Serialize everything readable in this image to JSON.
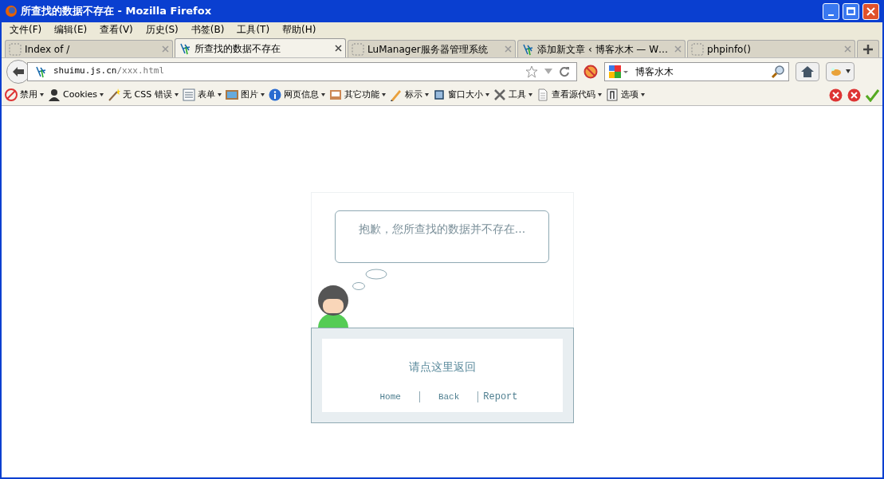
{
  "window": {
    "title": "所查找的数据不存在 - Mozilla Firefox"
  },
  "menu": [
    "文件(F)",
    "编辑(E)",
    "查看(V)",
    "历史(S)",
    "书签(B)",
    "工具(T)",
    "帮助(H)"
  ],
  "tabs": [
    {
      "label": "Index of /",
      "kind": "blank",
      "selected": false
    },
    {
      "label": "所查找的数据不存在",
      "kind": "favicon",
      "selected": true
    },
    {
      "label": "LuManager服务器管理系统",
      "kind": "blank",
      "selected": false
    },
    {
      "label": "添加新文章 ‹ 博客水木 — W…",
      "kind": "favicon",
      "selected": false
    },
    {
      "label": "phpinfo()",
      "kind": "blank",
      "selected": false
    }
  ],
  "address": {
    "host": "shuimu.js.cn",
    "path": "/xxx.html"
  },
  "search": {
    "value": "博客水木"
  },
  "toolbar": [
    "禁用",
    "Cookies",
    "无 CSS 错误",
    "表单",
    "图片",
    "网页信息",
    "其它功能",
    "标示",
    "窗口大小",
    "工具",
    "查看源代码",
    "选项"
  ],
  "page": {
    "message": "抱歉，您所查找的数据并不存在...",
    "back_link": "请点这里返回",
    "links": [
      "Home",
      "Back",
      "Report"
    ]
  }
}
